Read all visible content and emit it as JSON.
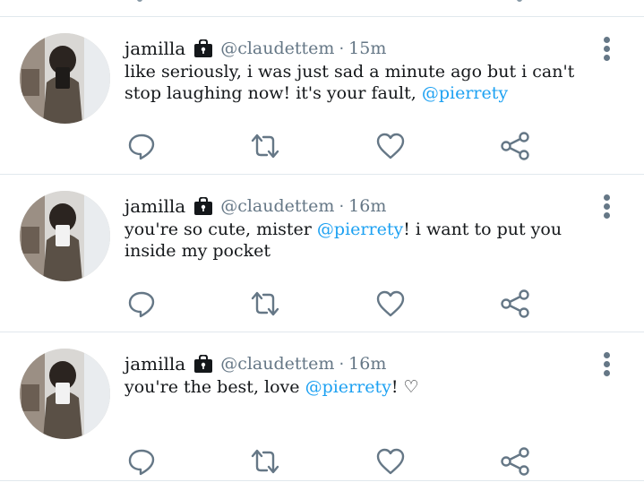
{
  "colors": {
    "text": "#14171a",
    "muted": "#657786",
    "mention": "#1da1f2",
    "divider": "#e1e8ed"
  },
  "icons": {
    "lock": "lock-icon",
    "more": "more-vertical-icon",
    "reply": "reply-bubble-icon",
    "retweet": "retweet-icon",
    "like": "heart-icon",
    "share": "share-icon"
  },
  "tweets": [
    {
      "name": "jamilla",
      "handle": "@claudettem",
      "separator": "·",
      "time": "15m",
      "text_parts": [
        "like seriously, i was just sad a minute ago but i can't stop laughing now! it's your fault, ",
        "@pierrety",
        ""
      ]
    },
    {
      "name": "jamilla",
      "handle": "@claudettem",
      "separator": "·",
      "time": "16m",
      "text_parts": [
        "you're so cute, mister ",
        "@pierrety",
        "! i want to put you inside my pocket"
      ]
    },
    {
      "name": "jamilla",
      "handle": "@claudettem",
      "separator": "·",
      "time": "16m",
      "text_parts": [
        "you're the best, love ",
        "@pierrety",
        "! ♡"
      ]
    }
  ]
}
